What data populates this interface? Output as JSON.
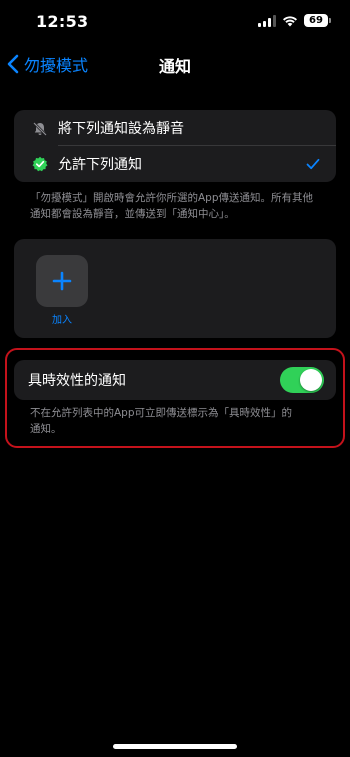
{
  "status_bar": {
    "time": "12:53",
    "battery": "69",
    "icons": [
      "cellular-signal-icon",
      "wifi-icon",
      "battery-icon"
    ]
  },
  "nav": {
    "back_label": "勿擾模式",
    "title": "通知"
  },
  "options": {
    "items": [
      {
        "label": "將下列通知設為靜音",
        "icon": "bell-slash-icon",
        "selected": false
      },
      {
        "label": "允許下列通知",
        "icon": "green-check-badge-icon",
        "selected": true
      }
    ],
    "footnote_lines": [
      "「勿擾模式」開啟時會允許你所選的App傳送通知。所有其他",
      "通知都會設為靜音，並傳送到「通知中心」。"
    ]
  },
  "apps": {
    "add_label": "加入"
  },
  "time_sensitive": {
    "label": "具時效性的通知",
    "enabled": true,
    "footnote_lines": [
      "不在允許列表中的App可立即傳送標示為「具時效性」的",
      "通知。"
    ]
  },
  "colors": {
    "accent": "#0a84ff",
    "toggle_on": "#30d158",
    "highlight": "#c4121b",
    "group_bg": "#1c1c1e"
  }
}
